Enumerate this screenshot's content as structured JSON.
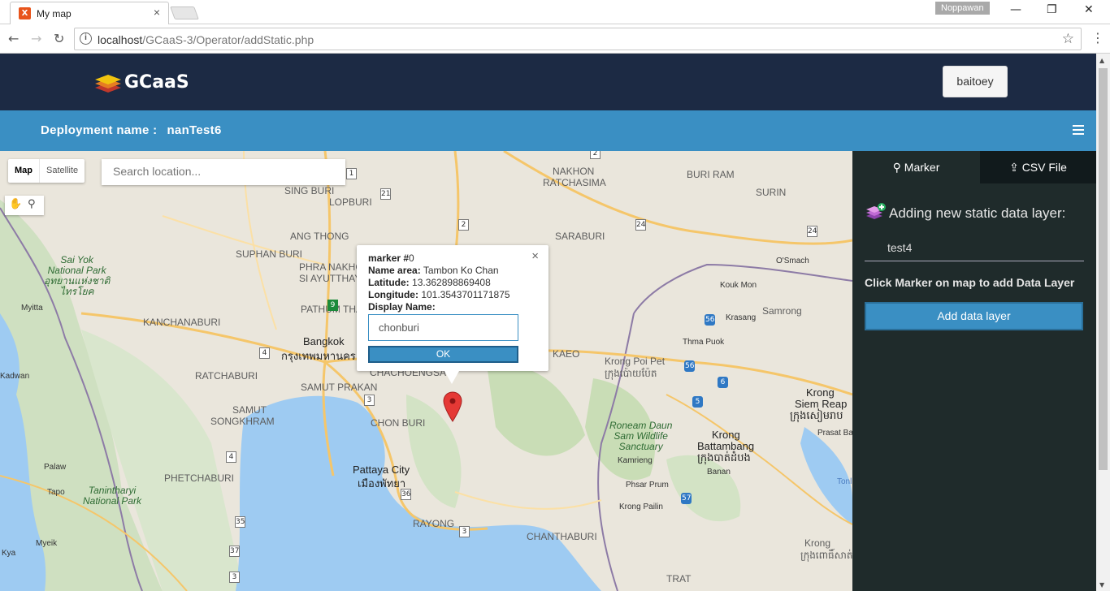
{
  "browser": {
    "tab_title": "My map",
    "tab_close": "×",
    "profile_name": "Noppawan",
    "url_host": "localhost",
    "url_path": "/GCaaS-3/Operator/addStatic.php",
    "min_icon": "—",
    "max_icon": "❐",
    "close_icon": "✕"
  },
  "header": {
    "logo_text": "GCaaS",
    "user_button": "baitoey",
    "deployment_label": "Deployment name :",
    "deployment_name": "nanTest6"
  },
  "map": {
    "map_type_map": "Map",
    "map_type_satellite": "Satellite",
    "search_placeholder": "Search location...",
    "labels": {
      "sing_buri": "SING BURI",
      "lop_buri": "LOPBURI",
      "ang_thong": "ANG THONG",
      "suphan_buri": "SUPHAN BURI",
      "phra_nakhon": "PHRA NAKHON",
      "si_ayutthaya": "SI AYUTTHAYA",
      "pathum_thani": "PATHUM THANI",
      "kanchanaburi": "KANCHANABURI",
      "bangkok": "Bangkok",
      "bangkok_th": "กรุงเทพมหานคร",
      "ratchaburi": "RATCHABURI",
      "samut_prakan": "SAMUT PRAKAN",
      "samut": "SAMUT",
      "songkhram": "SONGKHRAM",
      "chon_buri": "CHON BURI",
      "chachoengsao": "CHACHOENGSAO",
      "pattaya": "Pattaya City",
      "pattaya_th": "เมืองพัทยา",
      "phetchaburi": "PHETCHABURI",
      "rayong": "RAYONG",
      "chanthaburi": "CHANTHABURI",
      "nakhon": "NAKHON",
      "ratchasima": "RATCHASIMA",
      "buri_ram": "BURI RAM",
      "surin": "SURIN",
      "sa_kaeo": "KAEO",
      "saraburi": "SARABURI",
      "sai_yok_1": "Sai Yok",
      "sai_yok_2": "National Park",
      "sai_yok_th1": "อุทยานแห่งชาติ",
      "sai_yok_th2": "ไทรโยค",
      "tanintharyi_1": "Tanintharyi",
      "tanintharyi_2": "National Park",
      "mytta": "Myitta",
      "kadwan": "Kadwan",
      "palaw": "Palaw",
      "tapo": "Tapo",
      "myeik": "Myeik",
      "kya": "Kya",
      "krong_poi_pet": "Krong Poi Pet",
      "krong_poi_pet_kh": "ក្រុងប៉ោយប៉ែត",
      "roneam_1": "Roneam Daun",
      "roneam_2": "Sam Wildlife",
      "roneam_3": "Sanctuary",
      "krong_battambang_1": "Krong",
      "krong_battambang_2": "Battambang",
      "krong_battambang_kh": "ក្រុងបាត់ដំបង",
      "krong_siem_reap_1": "Krong",
      "krong_siem_reap_2": "Siem Reap",
      "krong_siem_reap_kh": "ក្រុងសៀមរាប",
      "samrong": "Samrong",
      "krasang": "Krasang",
      "kouk_mon": "Kouk Mon",
      "thma_puok": "Thma Puok",
      "osmach": "O'Smach",
      "kamrieng": "Kamrieng",
      "phsar_prum": "Phsar Prum",
      "krong_pailin": "Krong Pailin",
      "banan": "Banan",
      "prasat_bakan": "Prasat Bak",
      "krong": "Krong",
      "krong_kh": "ក្រុងពោធិ៍សាត់",
      "trat": "TRAT",
      "tonle": "Tonl"
    },
    "shields": [
      "1",
      "2",
      "21",
      "2",
      "24",
      "24",
      "21",
      "9",
      "4",
      "3",
      "3",
      "4",
      "36",
      "35",
      "37",
      "3",
      "56",
      "56",
      "6",
      "5",
      "57",
      "2"
    ]
  },
  "infowindow": {
    "title_label": "marker #",
    "title_value": "0",
    "name_area_label": "Name area:",
    "name_area_value": "Tambon Ko Chan",
    "latitude_label": "Latitude:",
    "latitude_value": "13.362898869408",
    "longitude_label": "Longitude:",
    "longitude_value": "101.3543701171875",
    "display_name_label": "Display Name:",
    "display_name_value": "chonburi",
    "ok_label": "OK",
    "close_label": "×"
  },
  "panel": {
    "tab_marker": "Marker",
    "tab_csv": "CSV File",
    "heading": "Adding new static data layer:",
    "layer_name_value": "test4",
    "hint": "Click Marker on map to add Data Layer",
    "add_button": "Add data layer"
  },
  "colors": {
    "header_bg": "#1c2a44",
    "accent_blue": "#3a8fc3",
    "panel_bg": "#1f2b2b",
    "marker_red": "#e53935"
  }
}
